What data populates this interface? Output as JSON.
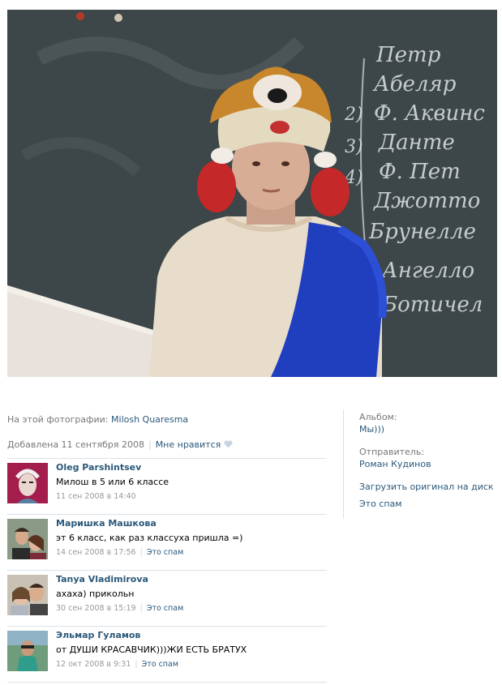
{
  "photo": {
    "chalkboard_lines": [
      "Петр",
      "Абеляр",
      "Ф. Аквинс",
      "Данте",
      "Ф. Пет",
      "Джотто",
      "Брунелле",
      "Ангелло",
      "Ботичел"
    ],
    "chalkboard_numbers": [
      "2)",
      "3)",
      "4)"
    ],
    "colors": {
      "board": "#3b4446",
      "shirt": "#e8dccb",
      "sash": "#1f3fbf",
      "wall": "#e9e2dc"
    }
  },
  "tags": {
    "label": "На этой фотографии:",
    "person": "Milosh Quaresma"
  },
  "meta": {
    "added": "Добавлена 11 сентября 2008",
    "like": "Мне нравится"
  },
  "comments": [
    {
      "author": "Oleg Parshintsev",
      "text": "Милош в 5 или 6 классе",
      "date": "11 сен 2008 в 14:40",
      "spam": ""
    },
    {
      "author": "Маришка Машкова",
      "text": "эт 6 класс, как раз классуха пришла =)",
      "date": "14 сен 2008 в 17:56",
      "spam": "Это спам"
    },
    {
      "author": "Tanya Vladimirova",
      "text": "ахаха) прикольн",
      "date": "30 сен 2008 в 15:19",
      "spam": "Это спам"
    },
    {
      "author": "Эльмар Гуламов",
      "text": "от ДУШИ КРАСАВЧИК)))ЖИ ЕСТЬ БРАТУХ",
      "date": "12 окт 2008 в 9:31",
      "spam": "Это спам"
    }
  ],
  "sidebar": {
    "album_label": "Альбом:",
    "album_name": "Мы)))",
    "sender_label": "Отправитель:",
    "sender_name": "Роман Кудинов",
    "upload": "Загрузить оригинал на диск",
    "spam": "Это спам"
  },
  "colors": {
    "link": "#2b587a",
    "muted": "#777777",
    "divider": "#dae1e8"
  }
}
